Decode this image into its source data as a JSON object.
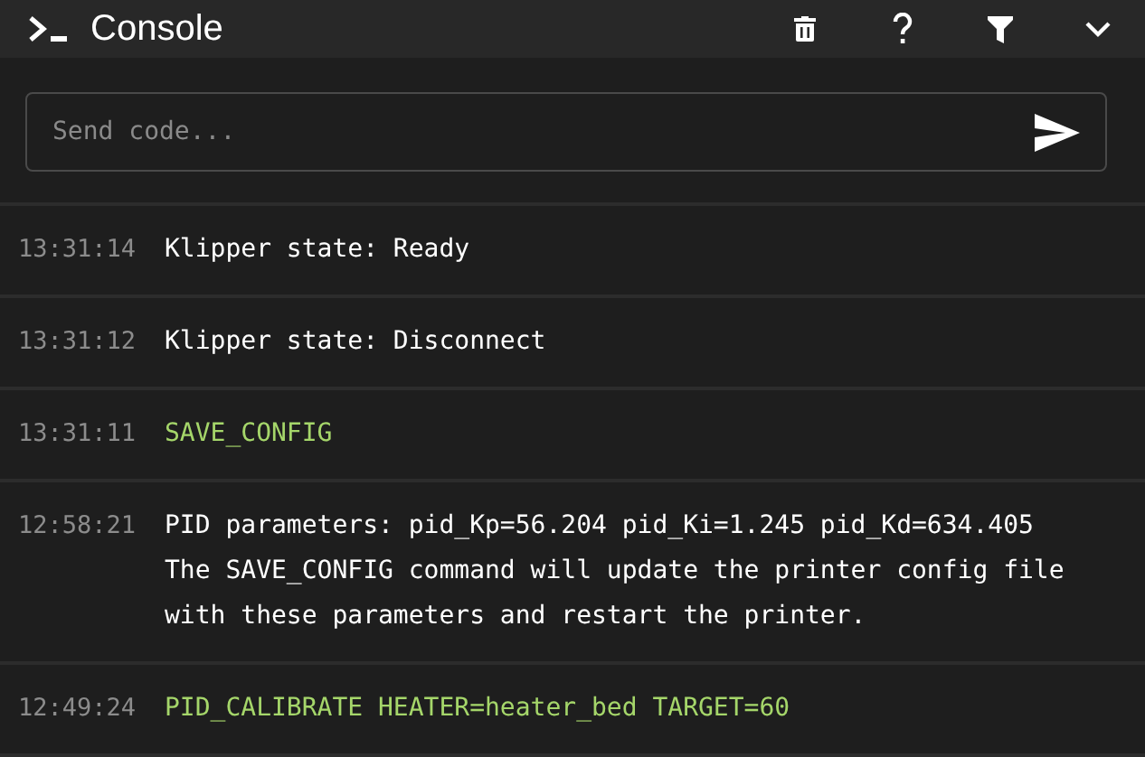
{
  "header": {
    "title": "Console"
  },
  "input": {
    "placeholder": "Send code..."
  },
  "entries": [
    {
      "time": "13:31:14",
      "kind": "response",
      "lines": [
        "Klipper state: Ready"
      ]
    },
    {
      "time": "13:31:12",
      "kind": "response",
      "lines": [
        "Klipper state: Disconnect"
      ]
    },
    {
      "time": "13:31:11",
      "kind": "command",
      "lines": [
        "SAVE_CONFIG"
      ]
    },
    {
      "time": "12:58:21",
      "kind": "response",
      "lines": [
        "PID parameters: pid_Kp=56.204 pid_Ki=1.245 pid_Kd=634.405",
        "The SAVE_CONFIG command will update the printer config file",
        "with these parameters and restart the printer."
      ]
    },
    {
      "time": "12:49:24",
      "kind": "command",
      "lines": [
        "PID_CALIBRATE HEATER=heater_bed TARGET=60"
      ]
    }
  ]
}
